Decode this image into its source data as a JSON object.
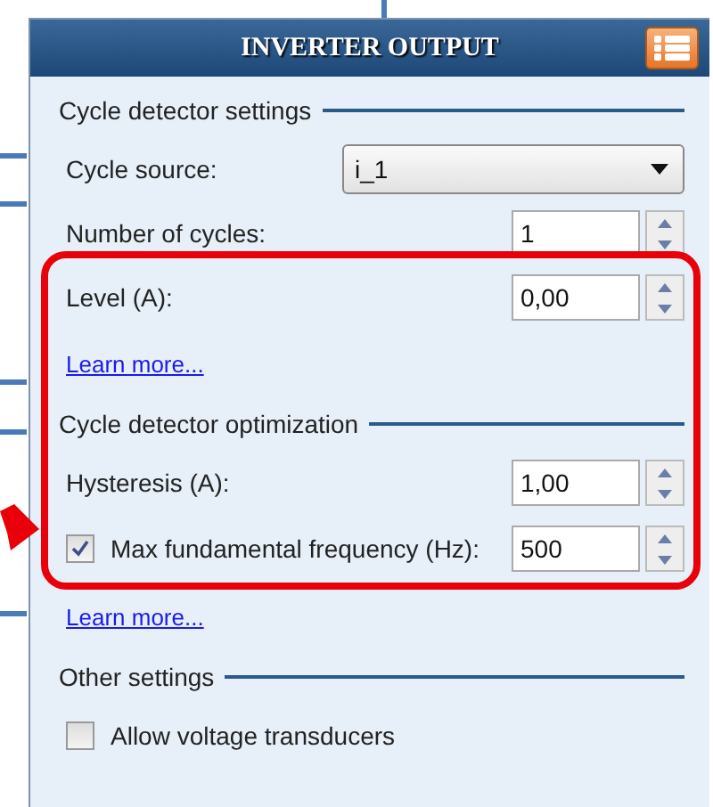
{
  "panel": {
    "title": "INVERTER OUTPUT"
  },
  "sections": [
    {
      "title": "Cycle detector settings",
      "items": [
        {
          "kind": "select",
          "label": "Cycle source:",
          "value": "i_1"
        },
        {
          "kind": "spinner",
          "label": "Number of cycles:",
          "value": "1"
        },
        {
          "kind": "spinner",
          "label": "Level (A):",
          "value": "0,00"
        },
        {
          "kind": "link",
          "label": "Learn more..."
        }
      ]
    },
    {
      "title": "Cycle detector optimization",
      "items": [
        {
          "kind": "spinner",
          "label": "Hysteresis (A):",
          "value": "1,00"
        },
        {
          "kind": "checkspinner",
          "label": "Max fundamental frequency (Hz):",
          "value": "500",
          "checked": true
        },
        {
          "kind": "link",
          "label": "Learn more..."
        }
      ]
    },
    {
      "title": "Other settings",
      "items": [
        {
          "kind": "checkbox",
          "label": "Allow voltage transducers",
          "checked": false
        }
      ]
    }
  ]
}
